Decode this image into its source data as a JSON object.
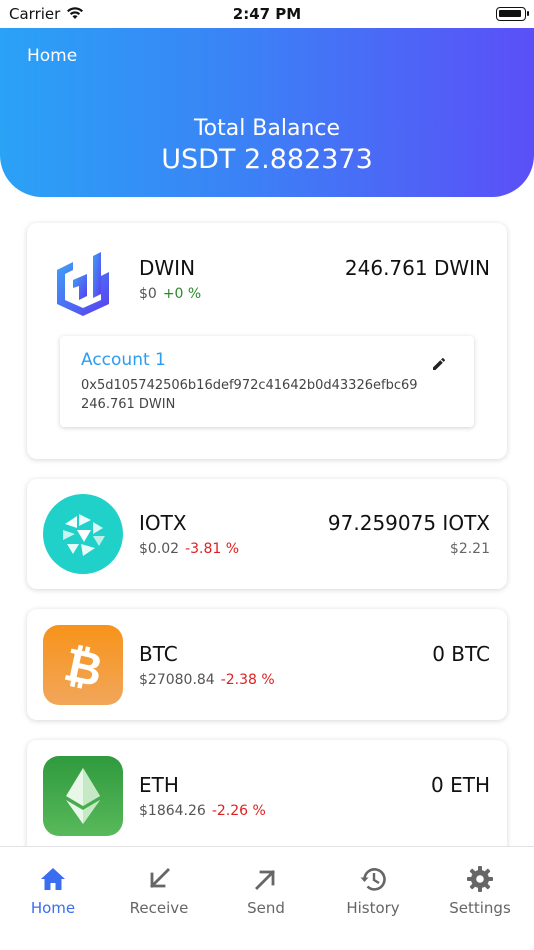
{
  "status_bar": {
    "carrier": "Carrier",
    "time": "2:47 PM"
  },
  "header": {
    "title": "Home",
    "total_label": "Total Balance",
    "total_value": "USDT 2.882373",
    "gradient": [
      "#2aa2f6",
      "#5b4ff7"
    ]
  },
  "assets": [
    {
      "symbol": "DWIN",
      "price": "$0",
      "change": "+0 %",
      "amount": "246.761 DWIN",
      "fiat": "",
      "icon": "dwin-logo-icon",
      "account": {
        "name": "Account 1",
        "address": "0x5d105742506b16def972c41642b0d43326efbc69",
        "balance": "246.761 DWIN"
      }
    },
    {
      "symbol": "IOTX",
      "price": "$0.02",
      "change": "-3.81 %",
      "amount": "97.259075 IOTX",
      "fiat": "$2.21",
      "icon": "iotx-logo-icon"
    },
    {
      "symbol": "BTC",
      "price": "$27080.84",
      "change": "-2.38 %",
      "amount": "0 BTC",
      "fiat": "",
      "icon": "btc-logo-icon"
    },
    {
      "symbol": "ETH",
      "price": "$1864.26",
      "change": "-2.26 %",
      "amount": "0 ETH",
      "fiat": "",
      "icon": "eth-logo-icon"
    }
  ],
  "tabs": [
    {
      "label": "Home",
      "icon": "home-icon",
      "active": true
    },
    {
      "label": "Receive",
      "icon": "arrow-down-left-icon",
      "active": false
    },
    {
      "label": "Send",
      "icon": "arrow-up-right-icon",
      "active": false
    },
    {
      "label": "History",
      "icon": "history-icon",
      "active": false
    },
    {
      "label": "Settings",
      "icon": "gear-icon",
      "active": false
    }
  ],
  "colors": {
    "accent": "#3b6df0",
    "positive": "#2a8a2a",
    "negative": "#e02020",
    "account_link": "#2d9cf0"
  }
}
